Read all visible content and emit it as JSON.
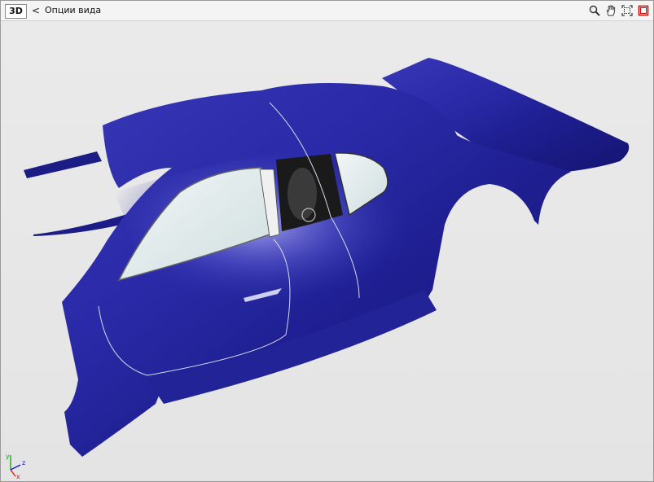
{
  "toolbar": {
    "mode_badge": "3D",
    "back_glyph": "<",
    "view_options_label": "Опции вида",
    "tools": [
      {
        "icon": "zoom-icon"
      },
      {
        "icon": "pan-hand-icon"
      },
      {
        "icon": "fit-view-icon"
      },
      {
        "icon": "close-window-icon"
      }
    ]
  },
  "viewport": {
    "model_color": "#1f1f8f",
    "background_color": "#e8e8e8"
  },
  "axis_triad": {
    "y_label": "y",
    "z_label": "z",
    "x_label": "x"
  },
  "colors": {
    "x_axis": "#e01010",
    "y_axis": "#10a010",
    "z_axis": "#1010d0",
    "close_icon": "#cc1010"
  }
}
